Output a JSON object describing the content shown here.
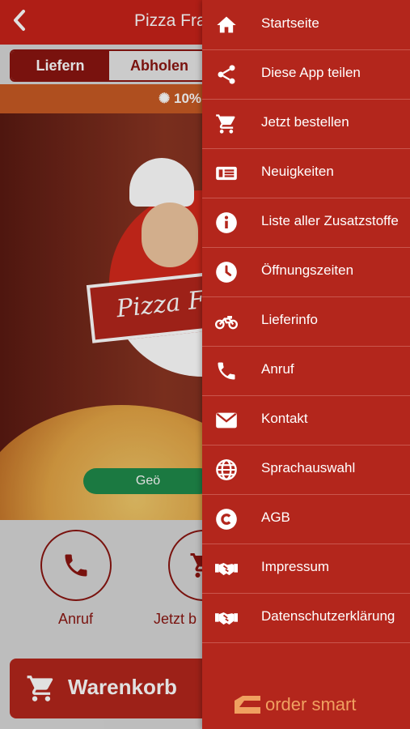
{
  "header": {
    "title": "Pizza Fran"
  },
  "order_mode": {
    "tabs": [
      "Liefern",
      "Abholen"
    ],
    "active": "Liefern"
  },
  "promo": {
    "text": "10%"
  },
  "hero": {
    "logo_text": "Pizza F",
    "hours_button": "Geö"
  },
  "actions": [
    {
      "label": "Anruf",
      "icon": "phone-icon"
    },
    {
      "label": "Jetzt b",
      "icon": "cart-icon"
    }
  ],
  "cart": {
    "label": "Warenkorb"
  },
  "drawer": {
    "items": [
      {
        "label": "Startseite",
        "icon": "home-icon"
      },
      {
        "label": "Diese App teilen",
        "icon": "share-icon"
      },
      {
        "label": "Jetzt bestellen",
        "icon": "cart-icon"
      },
      {
        "label": "Neuigkeiten",
        "icon": "news-icon"
      },
      {
        "label": "Liste aller Zusatzstoffe",
        "icon": "info-icon"
      },
      {
        "label": "Öffnungszeiten",
        "icon": "clock-icon"
      },
      {
        "label": "Lieferinfo",
        "icon": "motorbike-icon"
      },
      {
        "label": "Anruf",
        "icon": "phone-icon"
      },
      {
        "label": "Kontakt",
        "icon": "mail-icon"
      },
      {
        "label": "Sprachauswahl",
        "icon": "globe-icon"
      },
      {
        "label": "AGB",
        "icon": "copyright-icon"
      },
      {
        "label": "Impressum",
        "icon": "handshake-icon"
      },
      {
        "label": "Datenschutzerklärung",
        "icon": "handshake-icon"
      }
    ],
    "brand": "order smart"
  },
  "colors": {
    "primary": "#b3261c",
    "accent": "#8a1510",
    "brand_orange": "#f0a060",
    "promo": "#c85a24"
  }
}
